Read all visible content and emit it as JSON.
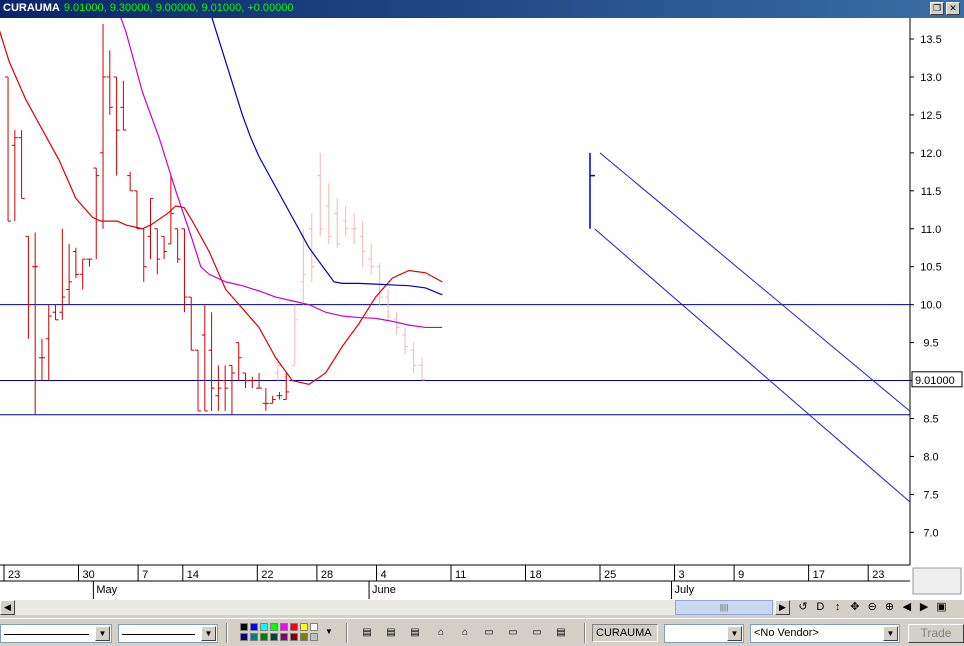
{
  "window": {
    "symbol": "CURAUMA",
    "quote": "9.01000, 9.30000, 9.00000, 9.01000, +0.00000",
    "min_icon": "restore-icon",
    "close_icon": "close-icon"
  },
  "chart": {
    "last_price_label": "9.01000",
    "y_ticks": [
      {
        "v": 13.5,
        "label": "13.5"
      },
      {
        "v": 13.0,
        "label": "13.0"
      },
      {
        "v": 12.5,
        "label": "12.5"
      },
      {
        "v": 12.0,
        "label": "12.0"
      },
      {
        "v": 11.5,
        "label": "11.5"
      },
      {
        "v": 11.0,
        "label": "11.0"
      },
      {
        "v": 10.5,
        "label": "10.5"
      },
      {
        "v": 10.0,
        "label": "10.0"
      },
      {
        "v": 9.5,
        "label": "9.5"
      },
      {
        "v": 9.0,
        "label": "9.0"
      },
      {
        "v": 8.5,
        "label": "8.5"
      },
      {
        "v": 8.0,
        "label": "8.0"
      },
      {
        "v": 7.5,
        "label": "7.5"
      },
      {
        "v": 7.0,
        "label": "7.0"
      }
    ],
    "x_ticks": [
      {
        "i": 0,
        "label": "23"
      },
      {
        "i": 5,
        "label": "30"
      },
      {
        "i": 9,
        "label": "7"
      },
      {
        "i": 12,
        "label": "14"
      },
      {
        "i": 17,
        "label": "22"
      },
      {
        "i": 21,
        "label": "28"
      },
      {
        "i": 25,
        "label": "4"
      },
      {
        "i": 30,
        "label": "11"
      },
      {
        "i": 35,
        "label": "18"
      },
      {
        "i": 40,
        "label": "25"
      },
      {
        "i": 45,
        "label": "3"
      },
      {
        "i": 49,
        "label": "9"
      },
      {
        "i": 54,
        "label": "17"
      },
      {
        "i": 58,
        "label": "23"
      }
    ],
    "months": [
      {
        "i": 6,
        "label": "May"
      },
      {
        "i": 24.5,
        "label": "June"
      },
      {
        "i": 44.8,
        "label": "July"
      }
    ],
    "h_lines": [
      10.0,
      9.0,
      8.55
    ],
    "bars": [
      {
        "o": 13.0,
        "h": 13.0,
        "l": 11.1,
        "c": 11.1
      },
      {
        "o": 12.1,
        "h": 12.3,
        "l": 11.1,
        "c": 12.2
      },
      {
        "o": 12.2,
        "h": 12.3,
        "l": 11.4,
        "c": 11.4
      },
      {
        "o": 10.9,
        "h": 10.9,
        "l": 9.55,
        "c": 10.0
      },
      {
        "o": 10.5,
        "h": 10.95,
        "l": 8.55,
        "c": 10.5
      },
      {
        "o": 9.3,
        "h": 9.55,
        "l": 9.0,
        "c": 9.3
      },
      {
        "o": 9.55,
        "h": 10.0,
        "l": 9.0,
        "c": 9.85
      },
      {
        "o": 9.9,
        "h": 10.0,
        "l": 9.8,
        "c": 9.8
      },
      {
        "o": 9.9,
        "h": 11.0,
        "l": 9.8,
        "c": 10.1
      },
      {
        "o": 10.2,
        "h": 10.8,
        "l": 10.0,
        "c": 10.3
      },
      {
        "o": 10.7,
        "h": 10.75,
        "l": 10.35,
        "c": 10.4
      },
      {
        "o": 10.4,
        "h": 10.6,
        "l": 10.2,
        "c": 10.6
      },
      {
        "o": 10.6,
        "h": 10.6,
        "l": 10.5,
        "c": 10.6
      },
      {
        "o": 11.8,
        "h": 11.8,
        "l": 10.6,
        "c": 11.7
      },
      {
        "o": 12.0,
        "h": 13.7,
        "l": 11.0,
        "c": 13.0
      },
      {
        "o": 13.0,
        "h": 13.35,
        "l": 12.5,
        "c": 12.6
      },
      {
        "o": 13.0,
        "h": 13.0,
        "l": 11.7,
        "c": 12.3
      },
      {
        "o": 12.6,
        "h": 12.95,
        "l": 12.3,
        "c": 12.3
      },
      {
        "o": 11.7,
        "h": 11.75,
        "l": 11.5,
        "c": 11.5
      },
      {
        "o": 11.5,
        "h": 11.5,
        "l": 11.0,
        "c": 11.0
      },
      {
        "o": 11.0,
        "h": 11.0,
        "l": 10.3,
        "c": 10.5
      },
      {
        "o": 10.9,
        "h": 11.4,
        "l": 10.6,
        "c": 11.4
      },
      {
        "o": 11.0,
        "h": 11.0,
        "l": 10.4,
        "c": 10.6
      },
      {
        "o": 10.9,
        "h": 10.9,
        "l": 10.6,
        "c": 10.7
      },
      {
        "o": 10.8,
        "h": 11.7,
        "l": 10.8,
        "c": 11.2
      },
      {
        "o": 11.0,
        "h": 11.0,
        "l": 10.55,
        "c": 10.6
      },
      {
        "o": 11.0,
        "h": 11.0,
        "l": 9.9,
        "c": 10.1
      },
      {
        "o": 10.1,
        "h": 10.1,
        "l": 9.4,
        "c": 9.4
      },
      {
        "o": 9.4,
        "h": 9.4,
        "l": 8.6,
        "c": 8.6
      },
      {
        "o": 9.6,
        "h": 10.0,
        "l": 8.6,
        "c": 8.6
      },
      {
        "o": 9.4,
        "h": 9.9,
        "l": 8.6,
        "c": 8.9
      },
      {
        "o": 8.8,
        "h": 9.2,
        "l": 8.6,
        "c": 8.9
      },
      {
        "o": 9.0,
        "h": 9.2,
        "l": 8.6,
        "c": 8.9
      },
      {
        "o": 9.2,
        "h": 9.2,
        "l": 8.55,
        "c": 9.1
      },
      {
        "o": 9.5,
        "h": 9.5,
        "l": 9.0,
        "c": 9.3
      },
      {
        "o": 9.1,
        "h": 9.1,
        "l": 8.9,
        "c": 9.0
      },
      {
        "o": 9.0,
        "h": 9.05,
        "l": 8.9,
        "c": 9.0
      },
      {
        "o": 8.9,
        "h": 9.1,
        "l": 8.9,
        "c": 8.9
      },
      {
        "o": 8.7,
        "h": 8.9,
        "l": 8.6,
        "c": 8.7
      },
      {
        "o": 8.7,
        "h": 8.8,
        "l": 8.7,
        "c": 8.75
      },
      {
        "o": 8.8,
        "h": 8.85,
        "l": 8.75,
        "c": 8.8
      },
      {
        "o": 8.75,
        "h": 9.1,
        "l": 8.75,
        "c": 8.85
      }
    ],
    "faint_bars": [
      {
        "o": 9.1,
        "h": 9.3,
        "l": 9.0,
        "c": 9.2
      },
      {
        "o": 9.05,
        "h": 9.1,
        "l": 8.95,
        "c": 9.0
      },
      {
        "o": 9.2,
        "h": 10.0,
        "l": 9.2,
        "c": 9.8
      },
      {
        "o": 10.3,
        "h": 11.0,
        "l": 10.0,
        "c": 10.4
      },
      {
        "o": 11.0,
        "h": 11.2,
        "l": 10.3,
        "c": 10.5
      },
      {
        "o": 11.7,
        "h": 12.0,
        "l": 10.9,
        "c": 11.0
      },
      {
        "o": 11.3,
        "h": 11.6,
        "l": 10.8,
        "c": 10.9
      },
      {
        "o": 11.2,
        "h": 11.4,
        "l": 10.75,
        "c": 10.8
      },
      {
        "o": 11.1,
        "h": 11.3,
        "l": 10.9,
        "c": 11.0
      },
      {
        "o": 11.0,
        "h": 11.2,
        "l": 10.8,
        "c": 11.0
      },
      {
        "o": 10.9,
        "h": 11.1,
        "l": 10.5,
        "c": 10.7
      },
      {
        "o": 10.6,
        "h": 10.8,
        "l": 10.4,
        "c": 10.5
      },
      {
        "o": 10.5,
        "h": 10.55,
        "l": 10.0,
        "c": 10.1
      },
      {
        "o": 10.1,
        "h": 10.2,
        "l": 9.8,
        "c": 9.85
      },
      {
        "o": 9.8,
        "h": 9.9,
        "l": 9.6,
        "c": 9.7
      },
      {
        "o": 9.6,
        "h": 9.7,
        "l": 9.35,
        "c": 9.45
      },
      {
        "o": 9.4,
        "h": 9.5,
        "l": 9.1,
        "c": 9.2
      },
      {
        "o": 9.2,
        "h": 9.3,
        "l": 9.0,
        "c": 9.01
      }
    ],
    "ma_red": [
      [
        0,
        13.9
      ],
      [
        2,
        13.2
      ],
      [
        4,
        12.7
      ],
      [
        6,
        12.3
      ],
      [
        8,
        11.9
      ],
      [
        10,
        11.4
      ],
      [
        12,
        11.15
      ],
      [
        13,
        11.1
      ],
      [
        15,
        11.1
      ],
      [
        16,
        11.05
      ],
      [
        18,
        11.0
      ],
      [
        19,
        11.05
      ],
      [
        21,
        11.2
      ],
      [
        22,
        11.3
      ],
      [
        23,
        11.28
      ],
      [
        24,
        11.1
      ],
      [
        26,
        10.7
      ],
      [
        28,
        10.2
      ],
      [
        30,
        9.95
      ],
      [
        32,
        9.7
      ],
      [
        34,
        9.3
      ],
      [
        36,
        9.0
      ],
      [
        38,
        8.95
      ],
      [
        40,
        9.1
      ],
      [
        42,
        9.45
      ],
      [
        44,
        9.75
      ],
      [
        46,
        10.1
      ],
      [
        48,
        10.35
      ],
      [
        50,
        10.45
      ],
      [
        52,
        10.42
      ],
      [
        54,
        10.3
      ]
    ],
    "ma_magenta": [
      [
        14,
        14.2
      ],
      [
        16,
        13.6
      ],
      [
        18,
        12.8
      ],
      [
        20,
        12.2
      ],
      [
        22,
        11.5
      ],
      [
        24,
        10.85
      ],
      [
        25,
        10.5
      ],
      [
        26,
        10.4
      ],
      [
        28,
        10.3
      ],
      [
        30,
        10.25
      ],
      [
        32,
        10.18
      ],
      [
        34,
        10.1
      ],
      [
        36,
        10.05
      ],
      [
        38,
        10.0
      ],
      [
        40,
        9.9
      ],
      [
        42,
        9.85
      ],
      [
        44,
        9.83
      ],
      [
        46,
        9.82
      ],
      [
        48,
        9.78
      ],
      [
        50,
        9.73
      ],
      [
        52,
        9.7
      ],
      [
        54,
        9.7
      ]
    ],
    "ma_blue": [
      [
        26,
        13.9
      ],
      [
        28,
        13.2
      ],
      [
        30,
        12.5
      ],
      [
        31,
        12.2
      ],
      [
        32,
        11.95
      ],
      [
        34,
        11.55
      ],
      [
        36,
        11.15
      ],
      [
        38,
        10.75
      ],
      [
        40,
        10.45
      ],
      [
        41,
        10.3
      ],
      [
        42,
        10.28
      ],
      [
        44,
        10.28
      ],
      [
        46,
        10.27
      ],
      [
        48,
        10.26
      ],
      [
        50,
        10.25
      ],
      [
        52,
        10.22
      ],
      [
        54,
        10.13
      ]
    ],
    "channel_upper": [
      [
        40.2,
        12.0
      ],
      [
        63,
        8.5
      ]
    ],
    "channel_lower": [
      [
        39.5,
        11.0
      ],
      [
        63,
        7.3
      ]
    ],
    "blue_bracket": {
      "i": 40,
      "top": 12.0,
      "bottom": 11.0,
      "tick": 11.7
    }
  },
  "scroll": {
    "left_icon": "arrow-left-icon",
    "right_icon": "arrow-right-icon",
    "nav": [
      {
        "name": "refresh-icon",
        "glyph": "↺"
      },
      {
        "name": "daily-label",
        "glyph": "D"
      },
      {
        "name": "move-vertical-icon",
        "glyph": "↕"
      },
      {
        "name": "move-icon",
        "glyph": "✥"
      },
      {
        "name": "zoom-out-icon",
        "glyph": "⊖"
      },
      {
        "name": "zoom-in-icon",
        "glyph": "⊕"
      },
      {
        "name": "scroll-left-icon",
        "glyph": "◀"
      },
      {
        "name": "scroll-right-icon",
        "glyph": "▶"
      },
      {
        "name": "maximize-icon",
        "glyph": "▣"
      }
    ]
  },
  "toolbar": {
    "symbol_box": "CURAUMA",
    "vendor": "<No Vendor>",
    "trade_label": "Trade",
    "colors": [
      "#000000",
      "#0000ff",
      "#00ffff",
      "#00ff00",
      "#ff00ff",
      "#ff0000",
      "#ffff00",
      "#ffffff",
      "#000080",
      "#008080",
      "#008000",
      "#004040",
      "#800080",
      "#800000",
      "#808000",
      "#c0c0c0"
    ]
  }
}
